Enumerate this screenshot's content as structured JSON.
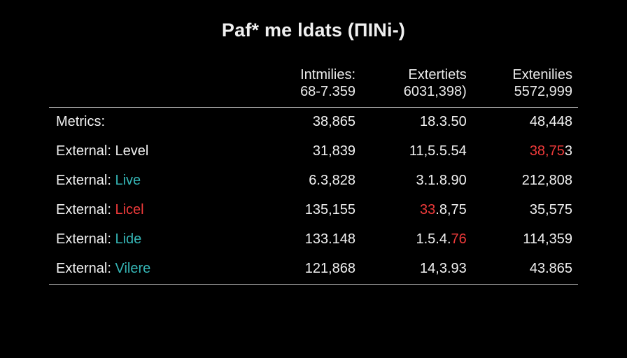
{
  "title": "Paf* me ldats (ПINi-)",
  "columns": [
    {
      "line1": "",
      "line2": ""
    },
    {
      "line1": "Intmilies:",
      "line2": "68-7.359"
    },
    {
      "line1": "Extertiets",
      "line2": "6031,398)"
    },
    {
      "line1": "Extenilies",
      "line2": "5572,999"
    }
  ],
  "rows": [
    {
      "label_prefix": "Metrics:",
      "label_tag": "",
      "tag_color": "",
      "cells": [
        {
          "text": "38,865"
        },
        {
          "text": "18.3.50"
        },
        {
          "text": "48,448"
        }
      ]
    },
    {
      "label_prefix": "External: Level",
      "label_tag": "",
      "tag_color": "",
      "cells": [
        {
          "text": "31,839"
        },
        {
          "text": "11,5.5.54"
        },
        {
          "pre": "38,75",
          "pre_color": "#ef3a3a",
          "post": "3"
        }
      ]
    },
    {
      "label_prefix": "External: ",
      "label_tag": "Live",
      "tag_color": "#35b6b6",
      "cells": [
        {
          "text": "6.3,828"
        },
        {
          "text": "3.1.8.90"
        },
        {
          "text": "212,808"
        }
      ]
    },
    {
      "label_prefix": "External: ",
      "label_tag": "Licel",
      "tag_color": "#ef3a3a",
      "cells": [
        {
          "text": "135,155"
        },
        {
          "pre": "33",
          "pre_color": "#ef3a3a",
          "post": ".8,75"
        },
        {
          "text": "35,575"
        }
      ]
    },
    {
      "label_prefix": "External: ",
      "label_tag": "Lide",
      "tag_color": "#35b6b6",
      "cells": [
        {
          "text": "133.148"
        },
        {
          "pre": "1.5.4.",
          "post": "76",
          "post_color": "#ef3a3a"
        },
        {
          "text": "114,359"
        }
      ]
    },
    {
      "label_prefix": "External: ",
      "label_tag": "Vilere",
      "tag_color": "#35b6b6",
      "cells": [
        {
          "text": "121,868"
        },
        {
          "text": "14,3.93"
        },
        {
          "text": "43.865"
        }
      ]
    }
  ],
  "chart_data": {
    "type": "table",
    "title": "Paf* me ldats (ПINi-)",
    "columns": [
      "",
      "Intmilies: 68-7.359",
      "Extertiets 6031,398)",
      "Extenilies 5572,999"
    ],
    "rows": [
      [
        "Metrics:",
        "38,865",
        "18.3.50",
        "48,448"
      ],
      [
        "External: Level",
        "31,839",
        "11,5.5.54",
        "38,753"
      ],
      [
        "External: Live",
        "6.3,828",
        "3.1.8.90",
        "212,808"
      ],
      [
        "External: Licel",
        "135,155",
        "33.8,75",
        "35,575"
      ],
      [
        "External: Lide",
        "133.148",
        "1.5.4.76",
        "114,359"
      ],
      [
        "External: Vilere",
        "121,868",
        "14,3.93",
        "43.865"
      ]
    ]
  }
}
